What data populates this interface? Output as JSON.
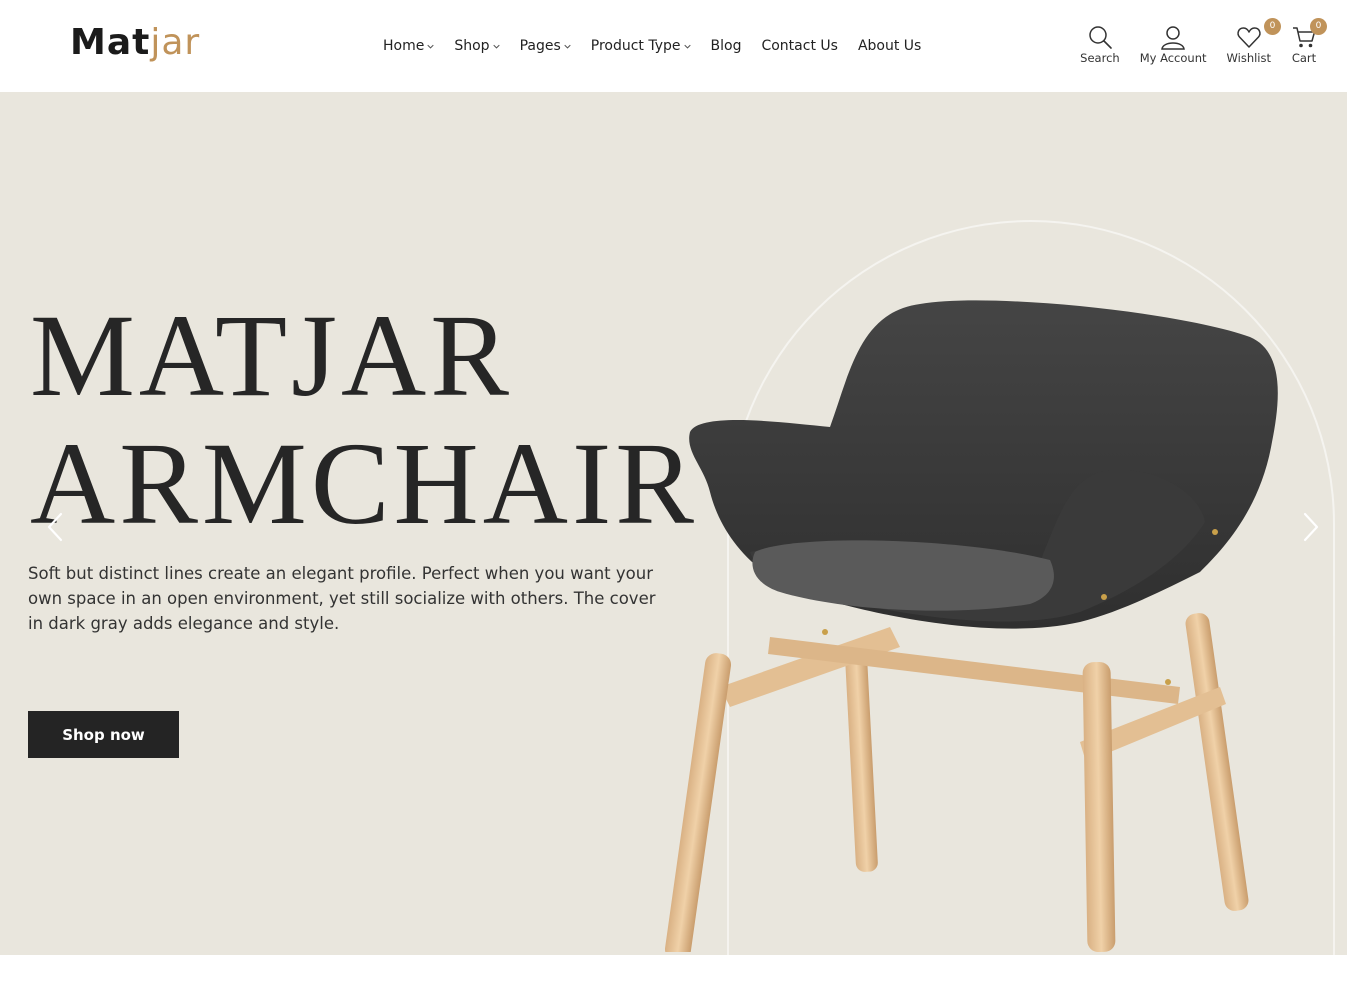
{
  "brand": {
    "logo_part1": "Mat",
    "logo_part2": "jar",
    "accent_color": "#c0935a"
  },
  "nav": {
    "items": [
      {
        "label": "Home",
        "has_dropdown": true
      },
      {
        "label": "Shop",
        "has_dropdown": true
      },
      {
        "label": "Pages",
        "has_dropdown": true
      },
      {
        "label": "Product Type",
        "has_dropdown": true
      },
      {
        "label": "Blog",
        "has_dropdown": false
      },
      {
        "label": "Contact Us",
        "has_dropdown": false
      },
      {
        "label": "About Us",
        "has_dropdown": false
      }
    ]
  },
  "actions": {
    "search": {
      "label": "Search",
      "icon": "search-icon"
    },
    "account": {
      "label": "My Account",
      "icon": "user-icon"
    },
    "wishlist": {
      "label": "Wishlist",
      "icon": "heart-icon",
      "count": "0"
    },
    "cart": {
      "label": "Cart",
      "icon": "cart-icon",
      "count": "0"
    }
  },
  "hero": {
    "title_line1": "MATJAR",
    "title_line2": "ARMCHAIR",
    "description": "Soft but distinct lines create an elegant profile. Perfect when you want your own space in an open environment, yet still socialize with others. The cover in dark gray adds elegance and style.",
    "cta_label": "Shop now",
    "background_color": "#e9e6dd",
    "prev_icon": "chevron-left-icon",
    "next_icon": "chevron-right-icon"
  }
}
